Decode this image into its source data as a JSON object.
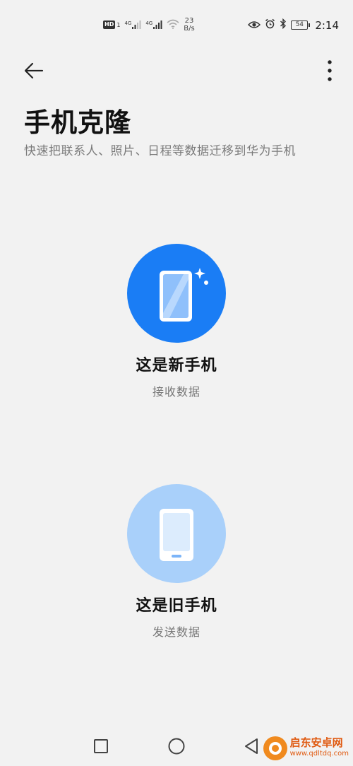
{
  "status_bar": {
    "hd_label": "HD",
    "sim1_label": "1",
    "net1": "4G",
    "net2": "4G",
    "speed_value": "23",
    "speed_unit": "B/s",
    "battery": "54",
    "time": "2:14"
  },
  "header": {
    "title": "手机克隆",
    "subtitle": "快速把联系人、照片、日程等数据迁移到华为手机"
  },
  "options": {
    "new_phone": {
      "title": "这是新手机",
      "subtitle": "接收数据",
      "color": "#1a7df5"
    },
    "old_phone": {
      "title": "这是旧手机",
      "subtitle": "发送数据",
      "color": "#a9d0fa"
    }
  },
  "icons": {
    "back": "arrow-left-icon",
    "more": "more-vertical-icon",
    "nav_recent": "square-icon",
    "nav_home": "circle-icon",
    "nav_back": "triangle-back-icon"
  },
  "watermark": {
    "name": "启东安卓网",
    "url": "www.qdltdq.com"
  }
}
